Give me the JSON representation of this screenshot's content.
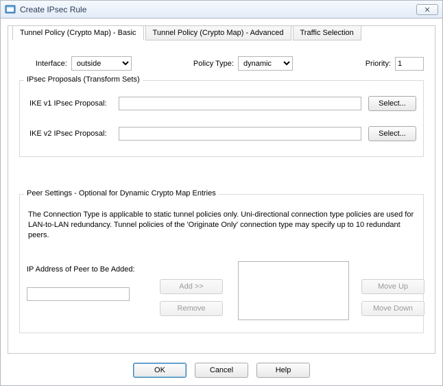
{
  "window": {
    "title": "Create IPsec Rule",
    "close_glyph": "✕"
  },
  "tabs": {
    "basic": "Tunnel Policy (Crypto Map) - Basic",
    "advanced": "Tunnel Policy (Crypto Map) - Advanced",
    "traffic": "Traffic Selection"
  },
  "toprow": {
    "interface_label": "Interface:",
    "interface_value": "outside",
    "policy_type_label": "Policy Type:",
    "policy_type_value": "dynamic",
    "priority_label": "Priority:",
    "priority_value": "1"
  },
  "proposals": {
    "legend": "IPsec Proposals (Transform Sets)",
    "ike1_label": "IKE v1 IPsec Proposal:",
    "ike1_value": "",
    "ike2_label": "IKE v2 IPsec Proposal:",
    "ike2_value": "",
    "select_label": "Select..."
  },
  "peer": {
    "legend": "Peer Settings  -  Optional for Dynamic Crypto Map Entries",
    "description": "The Connection Type is applicable to static tunnel policies only. Uni-directional connection type policies are used for LAN-to-LAN redundancy. Tunnel policies of the 'Originate Only' connection type may specify up to 10 redundant peers.",
    "ip_label": "IP Address of Peer to Be Added:",
    "ip_value": "",
    "add_label": "Add >>",
    "remove_label": "Remove",
    "moveup_label": "Move Up",
    "movedown_label": "Move Down",
    "peer_list": []
  },
  "buttons": {
    "ok": "OK",
    "cancel": "Cancel",
    "help": "Help"
  }
}
